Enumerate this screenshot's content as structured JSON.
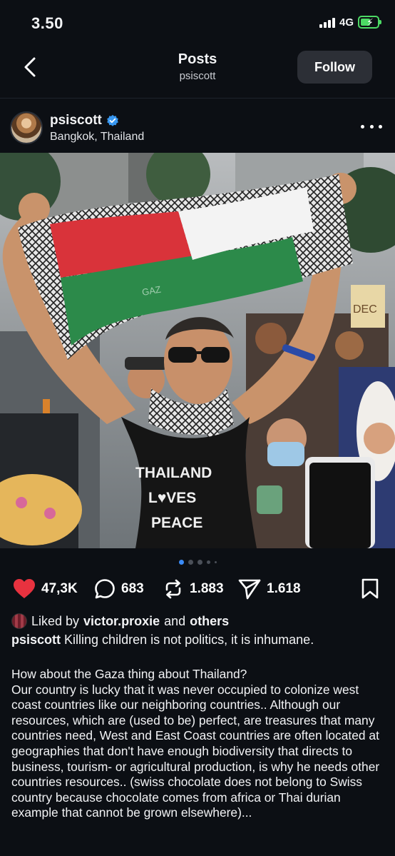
{
  "status_bar": {
    "time": "3.50",
    "network": "4G"
  },
  "header": {
    "title": "Posts",
    "subtitle": "psiscott",
    "follow_label": "Follow"
  },
  "post": {
    "username": "psiscott",
    "location": "Bangkok, Thailand",
    "shirt_text": [
      "THAILAND",
      "L♥VES",
      "PEACE"
    ],
    "sign_text": "DEC",
    "scarf_text": "GAZ",
    "carousel": {
      "count": 5,
      "active": 1
    }
  },
  "actions": {
    "likes": "47,3K",
    "comments": "683",
    "reposts": "1.883",
    "shares": "1.618"
  },
  "colors": {
    "like": "#e8323f",
    "active_dot": "#3b8bf6",
    "verified": "#3897f0"
  },
  "caption": {
    "liked_prefix": "Liked by",
    "liked_user": "victor.proxie",
    "liked_and": "and",
    "liked_others": "others",
    "author": "psiscott",
    "first_line": "Killing children is not politics, it is inhumane.",
    "body": "How about the Gaza thing about Thailand?\nOur country is lucky that it was never occupied to colonize west coast countries like our neighboring countries.. Although our resources, which are (used to be) perfect, are treasures that many countries need, West and East Coast countries are often located at geographies that don't have enough biodiversity that directs to business, tourism- or agricultural production, is why he needs other countries resources.. (swiss chocolate does not belong to Swiss country because chocolate comes from africa or Thai durian example that cannot be grown elsewhere)..."
  }
}
